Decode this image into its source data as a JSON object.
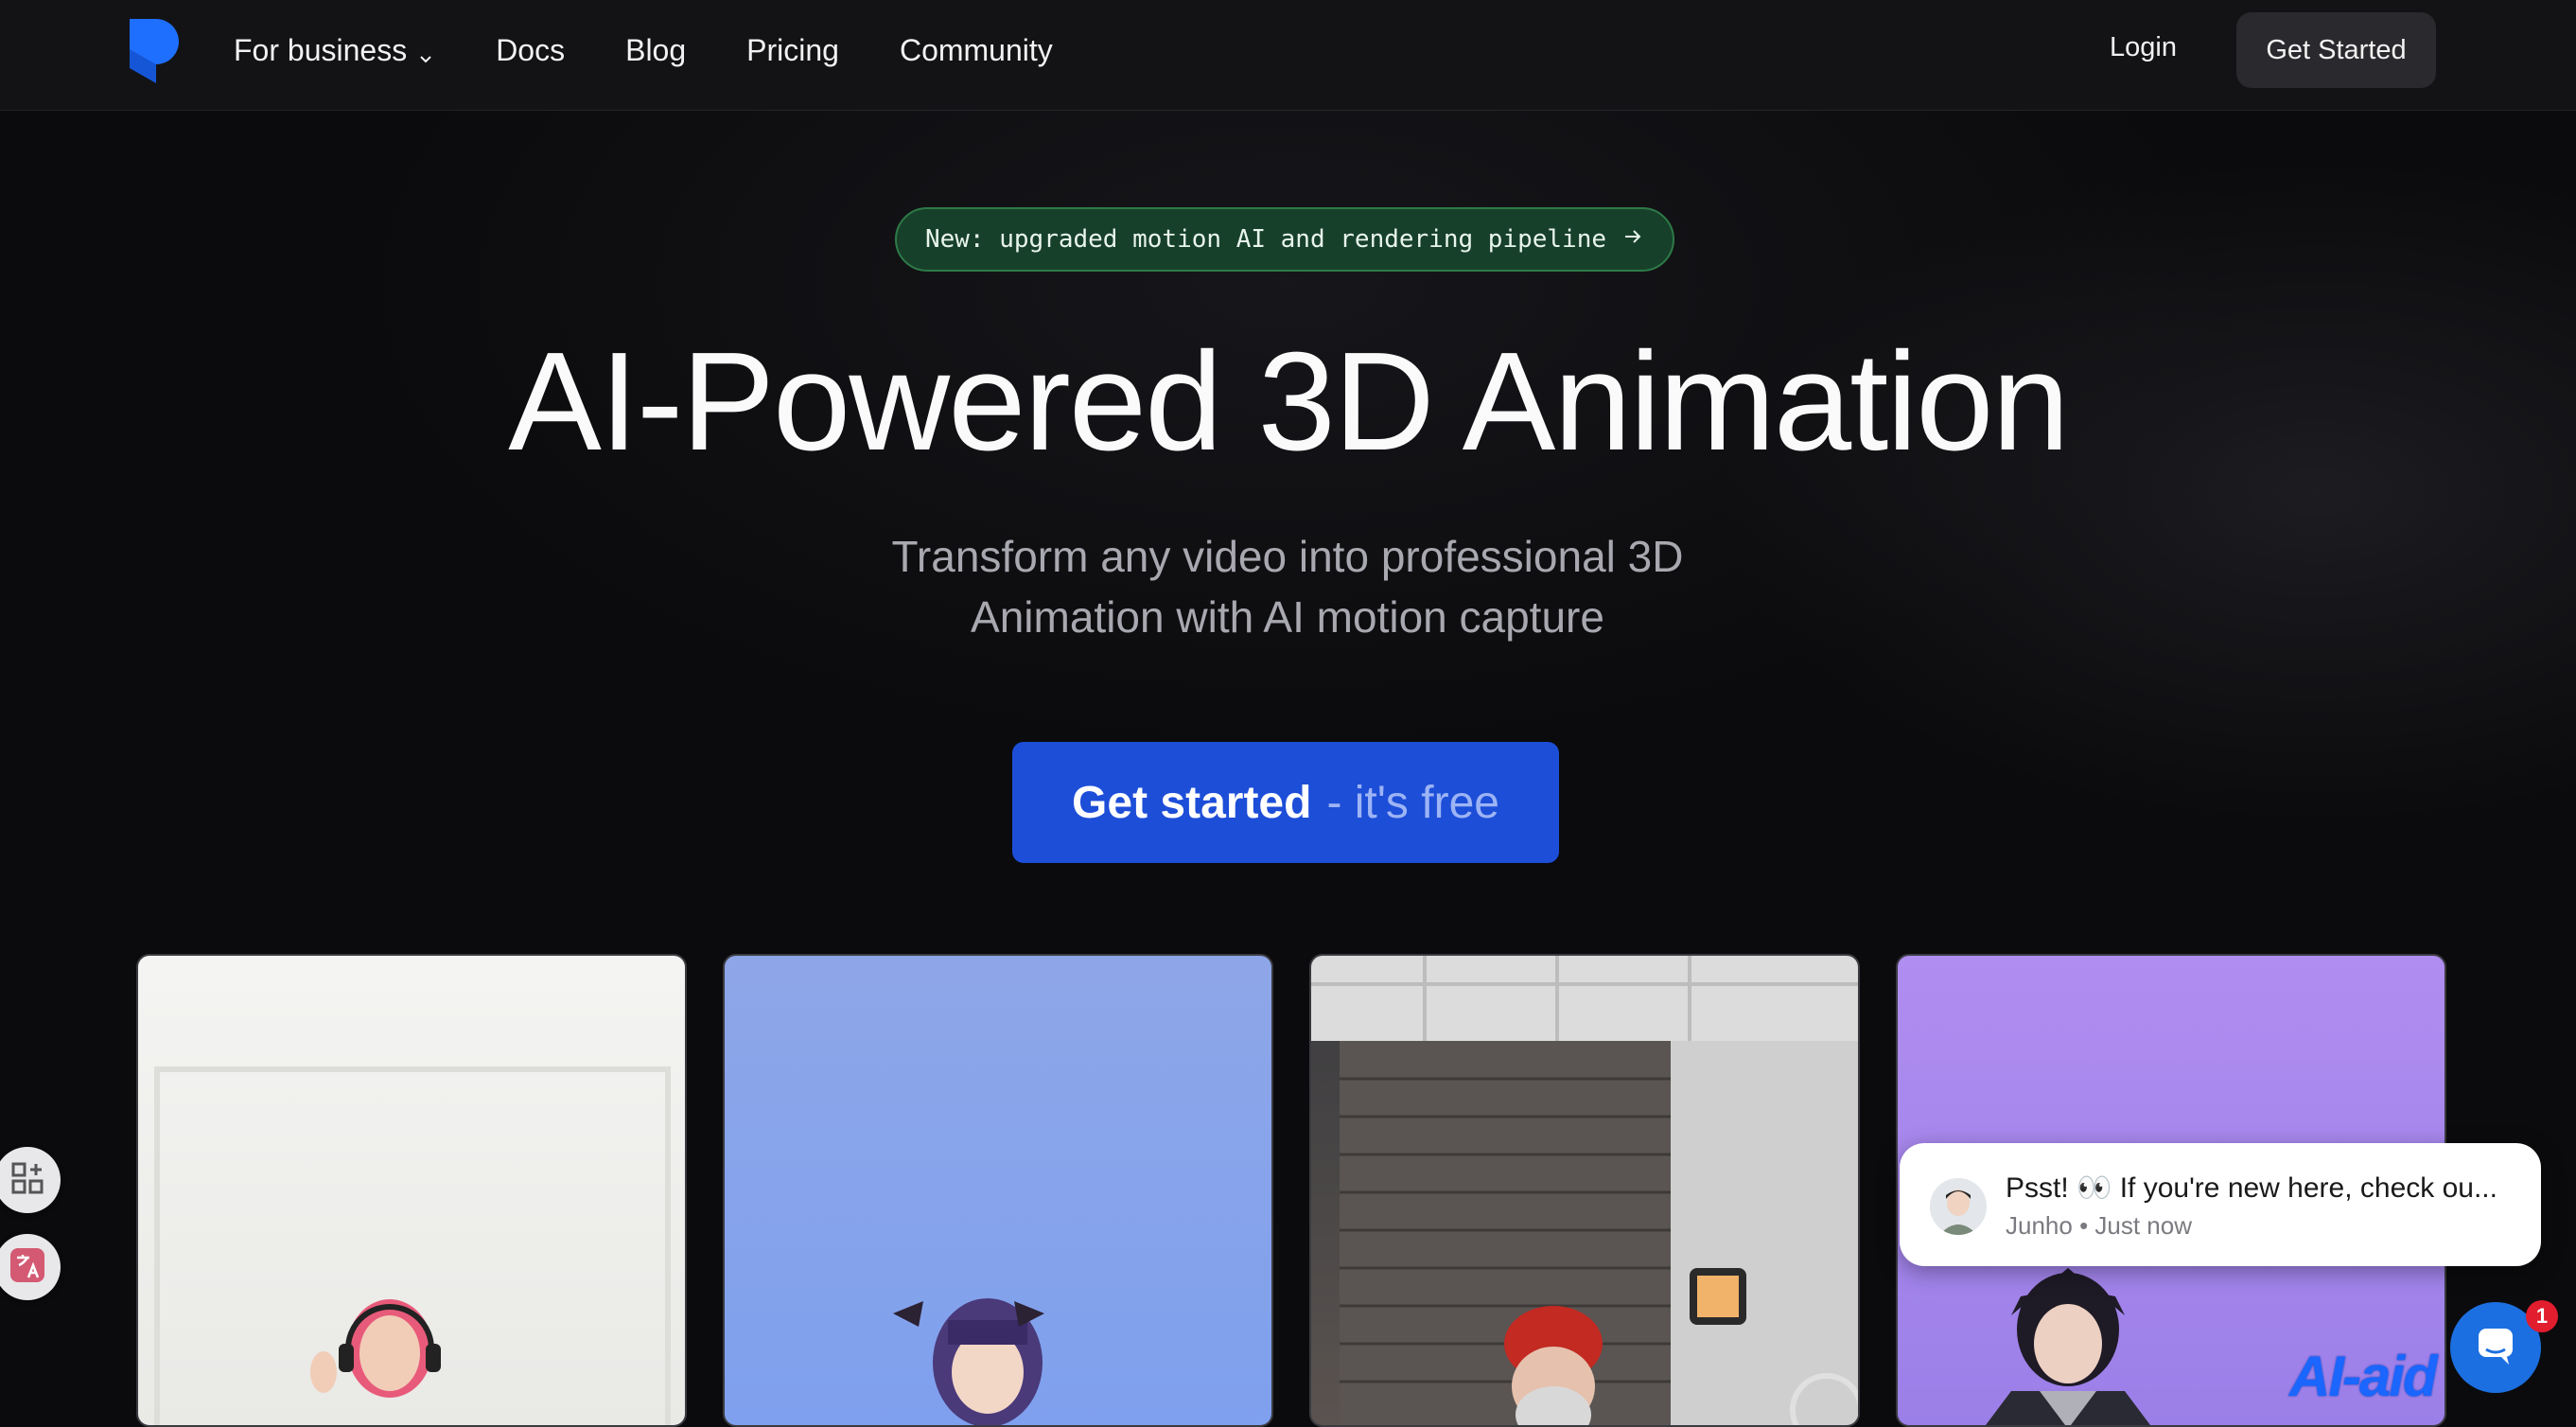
{
  "nav": {
    "items": [
      {
        "label": "For business",
        "has_dropdown": true
      },
      {
        "label": "Docs"
      },
      {
        "label": "Blog"
      },
      {
        "label": "Pricing"
      },
      {
        "label": "Community"
      }
    ],
    "login": "Login",
    "get_started": "Get Started"
  },
  "hero": {
    "announcement": "New: upgraded motion AI and rendering pipeline",
    "title": "AI-Powered 3D Animation",
    "subtitle_line1": "Transform any video into professional 3D",
    "subtitle_line2": "Animation with AI motion capture",
    "cta_main": "Get started",
    "cta_suffix": "- it's free"
  },
  "chat": {
    "message": "Psst! 👀 If you're new here, check ou...",
    "meta": "Junho • Just now",
    "badge_count": "1"
  },
  "watermark": "AI-aid",
  "colors": {
    "accent": "#1d4ed8",
    "announcement_bg": "#17402a",
    "logo_blue": "#1f6fff",
    "background": "#0b0b0d"
  },
  "icons": [
    "logo-icon",
    "chevron-down-icon",
    "arrow-right-icon",
    "apps-icon",
    "translate-icon",
    "chat-icon"
  ]
}
